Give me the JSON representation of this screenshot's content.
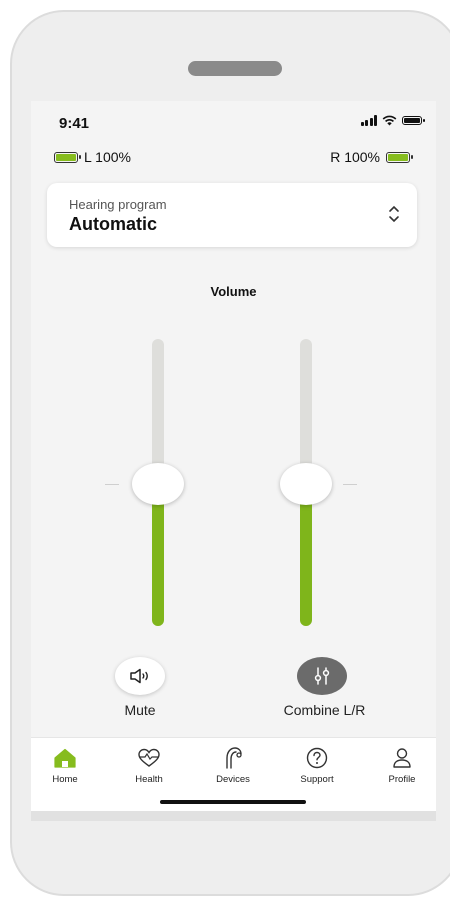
{
  "status": {
    "time": "9:41"
  },
  "battery": {
    "left_label": "L 100%",
    "right_label": "R 100%"
  },
  "program": {
    "label": "Hearing program",
    "value": "Automatic"
  },
  "volume": {
    "title": "Volume",
    "left_level": 0.43,
    "right_level": 0.43
  },
  "controls": {
    "mute_label": "Mute",
    "combine_label": "Combine L/R"
  },
  "tabs": [
    {
      "label": "Home",
      "icon": "home-icon",
      "active": true
    },
    {
      "label": "Health",
      "icon": "heart-icon",
      "active": false
    },
    {
      "label": "Devices",
      "icon": "hearing-aid-icon",
      "active": false
    },
    {
      "label": "Support",
      "icon": "question-icon",
      "active": false
    },
    {
      "label": "Profile",
      "icon": "user-icon",
      "active": false
    }
  ],
  "colors": {
    "accent": "#86bc1e",
    "slider_fill": "#7fb51b",
    "combine_bg": "#6b6b6b"
  }
}
